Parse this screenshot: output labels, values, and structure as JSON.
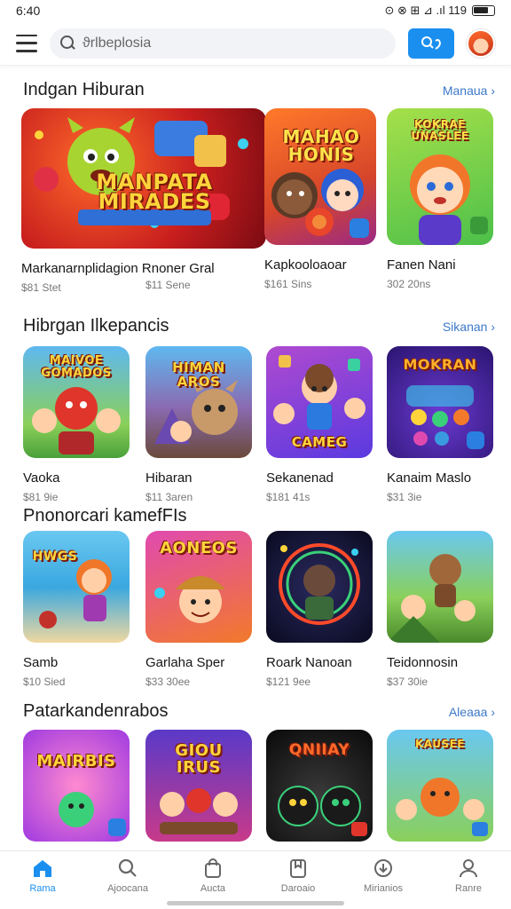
{
  "status_bar": {
    "time": "6:40",
    "icons": "⊙ ⊗ ⊞ ⊿ .ıl 119",
    "battery": "battery-icon"
  },
  "top_bar": {
    "search_placeholder": "ϑrlbeplosia",
    "action_label": "A ⌕",
    "avatar": "user-avatar"
  },
  "sections": [
    {
      "title": "Indgan Hiburan",
      "see_all": "Manaua ›",
      "games": [
        {
          "name": "Markanarnplidagion Rnoner Gral",
          "meta": "$81 Stet",
          "art": "MANPATA MIRADES"
        },
        {
          "name": "",
          "meta": "$11 Sene",
          "art": "MAHAO HONIS"
        },
        {
          "name": "Kapkooloaoar",
          "meta": "$161 Sins",
          "art": ""
        },
        {
          "name": "Fanen Nani",
          "meta": "302 20ns",
          "art": "KOKRAE UNASLEE"
        }
      ]
    },
    {
      "title": "Hibrgan Ilkepancis",
      "see_all": "Sikanan ›",
      "games": [
        {
          "name": "Vaoka",
          "meta": "$81 9ie",
          "art": "MAIVOE GOMADOS"
        },
        {
          "name": "Hibaran",
          "meta": "$11 3aren",
          "art": "HIMAN AROS"
        },
        {
          "name": "Sekanenad",
          "meta": "$181 41s",
          "art": "CAMEG"
        },
        {
          "name": "Kanaim Maslo",
          "meta": "$31 3ie",
          "art": "MOKRAN"
        }
      ]
    },
    {
      "title": "Pnonorcari kamefFIs",
      "see_all": "",
      "games": [
        {
          "name": "Samb",
          "meta": "$10 Sied",
          "art": "HWGS"
        },
        {
          "name": "Garlaha Sper",
          "meta": "$33 30ee",
          "art": "AONEOS"
        },
        {
          "name": "Roark Nanoan",
          "meta": "$121 9ee",
          "art": ""
        },
        {
          "name": "Teidonnosin",
          "meta": "$37 30ie",
          "art": ""
        }
      ]
    },
    {
      "title": "Patarkandenrabos",
      "see_all": "Aleaaa ›",
      "games": [
        {
          "name": "",
          "meta": "",
          "art": "MAIRBIS"
        },
        {
          "name": "",
          "meta": "",
          "art": "GIOU IRUS"
        },
        {
          "name": "",
          "meta": "",
          "art": "QNIIAY"
        },
        {
          "name": "",
          "meta": "",
          "art": "KAUSEE"
        }
      ]
    }
  ],
  "bottom_nav": [
    {
      "label": "Rama",
      "icon": "home-icon",
      "active": true
    },
    {
      "label": "Ajoocana",
      "icon": "search-icon",
      "active": false
    },
    {
      "label": "Aucta",
      "icon": "bag-icon",
      "active": false
    },
    {
      "label": "Daroaio",
      "icon": "bookmark-icon",
      "active": false
    },
    {
      "label": "Mirianios",
      "icon": "download-icon",
      "active": false
    },
    {
      "label": "Ranre",
      "icon": "profile-icon",
      "active": false
    }
  ],
  "colors": {
    "accent": "#1a8ff0",
    "see_all": "#3c78c8"
  }
}
